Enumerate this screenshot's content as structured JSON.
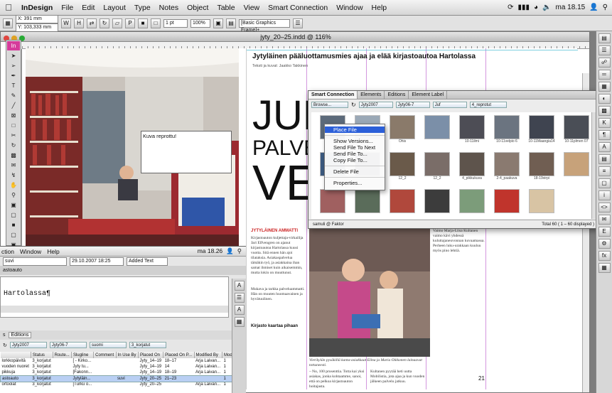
{
  "menubar": {
    "app": "InDesign",
    "items": [
      "File",
      "Edit",
      "Layout",
      "Type",
      "Notes",
      "Object",
      "Table",
      "View",
      "Smart Connection",
      "Window",
      "Help"
    ],
    "clock": "ma 18.15"
  },
  "controlbar": {
    "x": "X: 391 mm",
    "y": "Y: 103,333 mm",
    "stroke": "1 pt",
    "zoom": "100%",
    "style": "[Basic Graphics Frame]+"
  },
  "document": {
    "title": "jyty_20–25.indd @ 116%",
    "headline": "Jytyläinen pääluottamusmies ajaa ja elää kirjastoautoa Hartolassa",
    "byline": "Teksti ja kuvat: Jaakko Takkinen",
    "big1": "JUL",
    "big2": "PALVE",
    "big3": "VE",
    "photo_caption_box": "Kuva reprottu!",
    "section_tag": "JYTYLÄINEN AMMATTI",
    "subhead": "Kirjasto kaartaa pihaan",
    "photo_caption": "Vierikylän pysäkillä kanta-asiakkaat Elina ja Maria Oikkonen lainaavat tottuneesti.",
    "page_number": "21",
    "col_a": "Kirjastoauton kuljettaja-virkailija Jari Elfvengren on ajanut kirjastoautoa Hartolassa kuusi vuotta. Sitä ennen hän ajoi tilataksia. Asiakaspalvelua tämäkin työ, ja asiakkaina ihan samat ihmiset kuin aikaisemmin, mutta lokin on muuttunut.",
    "col_b": "Mukava ja tarkka palveluammatti. Hän on muuten huomaavainen ja hyvätuulinen.",
    "col_c": "Vaimo Marja-Liisa Kultanen vaimo kävi yhdessä kuluttajaneuvonnan kuvaamassa. Perheen luku-urakkaan kuuluu myös pino lehtiä.",
    "col_d": "– No, 100 prosenttia. Totta kai yksi asiakas, jonka kohtaamme, sanoi, että on pelkoa kirjastoauton hoitajasta.",
    "col_e": "Kultanen pyytää heti uutta Mobilistia, jota ajaa ja kun vuoden jälkeen palvelu jatkuu."
  },
  "smart_connection": {
    "tabs": [
      "Smart Connection",
      "Elements",
      "Editions",
      "Element Label"
    ],
    "filters": [
      "Browse...",
      "Jyty2007",
      "Jyty06-7",
      "Juf",
      "4_reprotut"
    ],
    "status_user": "samuli @ Faktor",
    "status_count": "Total 60 ( 1 – 60 displayed )",
    "thumbs": [
      {
        "label": "",
        "color": "#5c6a7a"
      },
      {
        "label": "",
        "color": "#9aa8b6"
      },
      {
        "label": "Ohis",
        "color": "#8a7a6a"
      },
      {
        "label": "",
        "color": "#7b8fa8"
      },
      {
        "label": "10-11ilmi",
        "color": "#4d4d55"
      },
      {
        "label": "10-11velpio 6",
        "color": "#6b7480"
      },
      {
        "label": "10-11Maangia14",
        "color": "#3f4450"
      },
      {
        "label": "10-11plmen 07",
        "color": "#4a4e56"
      },
      {
        "label": "",
        "color": "#3c5a80"
      },
      {
        "label": "",
        "color": "#2c3440"
      },
      {
        "label": "12_2",
        "color": "#6a5a4a"
      },
      {
        "label": "12_2",
        "color": "#7a6d68"
      },
      {
        "label": "4_pikkukuva",
        "color": "#5e544c"
      },
      {
        "label": "2-4_paakuva",
        "color": "#8a7a70"
      },
      {
        "label": "18-19virpi",
        "color": "#705e52"
      },
      {
        "label": "",
        "color": "#c7a27a"
      },
      {
        "label": "",
        "color": "#a06060"
      },
      {
        "label": "",
        "color": "#5a6c5a"
      },
      {
        "label": "",
        "color": "#b0483c"
      },
      {
        "label": "",
        "color": "#3c3c3c"
      },
      {
        "label": "",
        "color": "#7c9c7a"
      },
      {
        "label": "",
        "color": "#c0342c"
      },
      {
        "label": "",
        "color": "#d8c4a4"
      }
    ]
  },
  "context_menu": {
    "items": [
      "Place File",
      "Show Versions...",
      "Send File To Next",
      "Send File To...",
      "Copy File To...",
      "Delete File",
      "Properties..."
    ],
    "highlighted": "Place File"
  },
  "background_window": {
    "menu": [
      "ction",
      "Window",
      "Help"
    ],
    "clock": "ma 18.26",
    "user": "suvi",
    "date": "29.10.2007 18:25",
    "state": "Added Text",
    "title": "astoauto",
    "edit_text": "Hartolassa¶",
    "tabs": [
      "s",
      "Editions"
    ],
    "filter_a": "Jyty2007",
    "filter_b": "Jyty06-7",
    "filter_c": "suomi",
    "filter_d": "3_korjatut",
    "columns": [
      "",
      "Status",
      "Route...",
      "Slugline",
      "Comment",
      "In Use By",
      "Placed On",
      "Placed On P...",
      "Modified By",
      "Mod"
    ],
    "rows": [
      [
        "lorkkopäivitä",
        "3_korjatut",
        "",
        "[ - Kirko...",
        "",
        "",
        "Jyty_14–19",
        "18–17",
        "Arja Laivan...",
        "1"
      ],
      [
        "vuoden nuoret",
        "3_korjatut",
        "",
        "Jyty tu...",
        "",
        "",
        "Jyty_14–19",
        "14",
        "Arja Laivan...",
        "1"
      ],
      [
        "pikkuja",
        "3_korjatut",
        "",
        "[Fakonn...",
        "",
        "",
        "Jyty_14–19",
        "18–19",
        "Arja Laivan...",
        "1"
      ],
      [
        "astoauto",
        "3_korjatut",
        "",
        "Jytyläin...",
        "",
        "suvi",
        "Jyty_20–25",
        "21–23",
        "",
        "1"
      ],
      [
        "ortoolat",
        "3_korjatut",
        "",
        "[Turku o...",
        "",
        "",
        "Jyty_20–25",
        "",
        "Arja Laivan...",
        "1"
      ]
    ],
    "selected_row": 3
  }
}
